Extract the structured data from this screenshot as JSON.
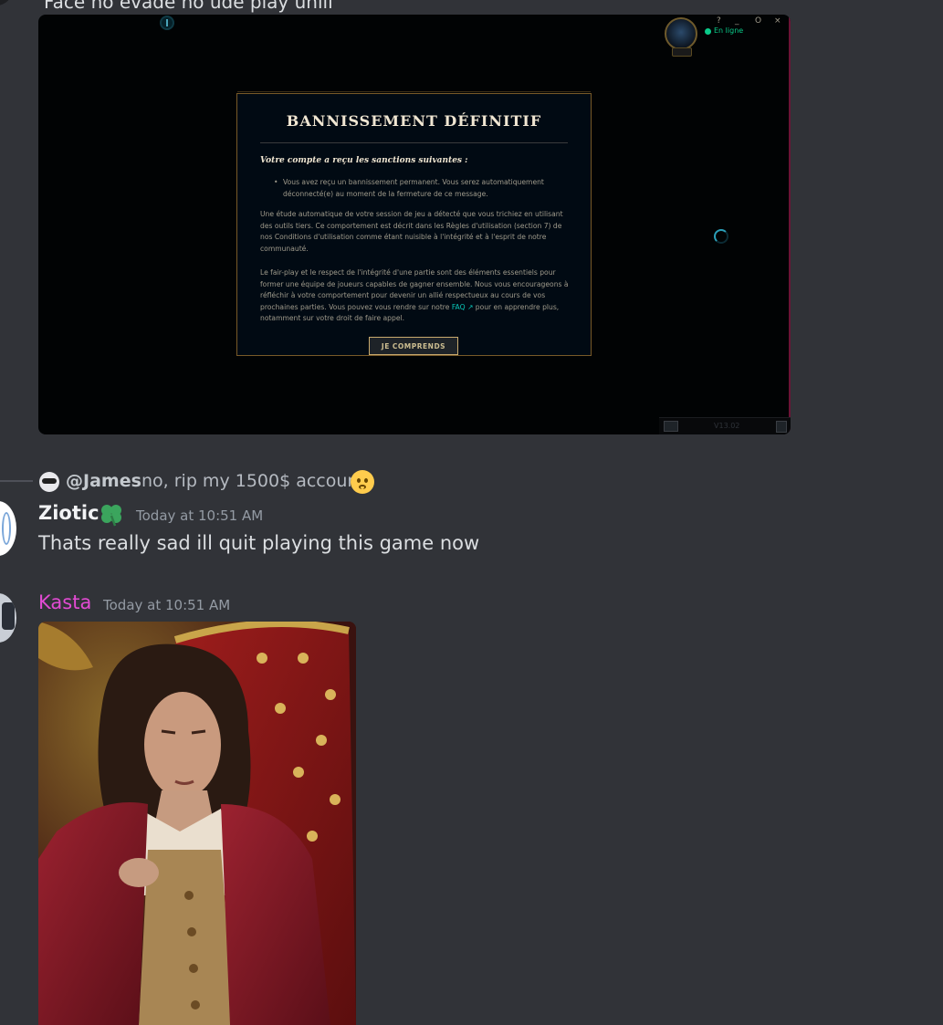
{
  "top_message": {
    "text": "Face no evade no ude play unill"
  },
  "game_client": {
    "status": "En ligne",
    "window_controls": [
      "?",
      "_",
      "O",
      "×"
    ],
    "chat_version": "V13.02"
  },
  "ban_dialog": {
    "title": "BANNISSEMENT DÉFINITIF",
    "subtitle": "Votre compte a reçu les sanctions suivantes :",
    "bullet": "Vous avez reçu un bannissement permanent. Vous serez automatiquement déconnecté(e) au moment de la fermeture de ce message.",
    "paragraph1": "Une étude automatique de votre session de jeu a détecté que vous trichiez en utilisant des outils tiers. Ce comportement est décrit dans les Règles d'utilisation (section 7) de nos Conditions d'utilisation comme étant nuisible à l'intégrité et à l'esprit de notre communauté.",
    "paragraph2_before": "Le fair-play et le respect de l'intégrité d'une partie sont des éléments essentiels pour former une équipe de joueurs capables de gagner ensemble. Nous vous encourageons à réfléchir à votre comportement pour devenir un allié respectueux au cours de vos prochaines parties. Vous pouvez vous rendre sur notre",
    "faq_label": "FAQ ↗",
    "paragraph2_after": "pour en apprendre plus, notamment sur votre droit de faire appel.",
    "button_label": "JE COMPRENDS"
  },
  "reply": {
    "mention": "@James",
    "text": "no, rip my 1500$ account"
  },
  "messages": [
    {
      "author": "Ziotic",
      "author_color": "#f2f3f5",
      "timestamp": "Today at 10:51 AM",
      "text": "Thats really sad ill quit playing this game now"
    },
    {
      "author": "Kasta",
      "author_color": "#e24bd3",
      "timestamp": "Today at 10:51 AM"
    }
  ],
  "colors": {
    "background": "#313338",
    "dialog_border": "#785a28",
    "link": "#0ac8b9",
    "online": "#0acb8a"
  }
}
